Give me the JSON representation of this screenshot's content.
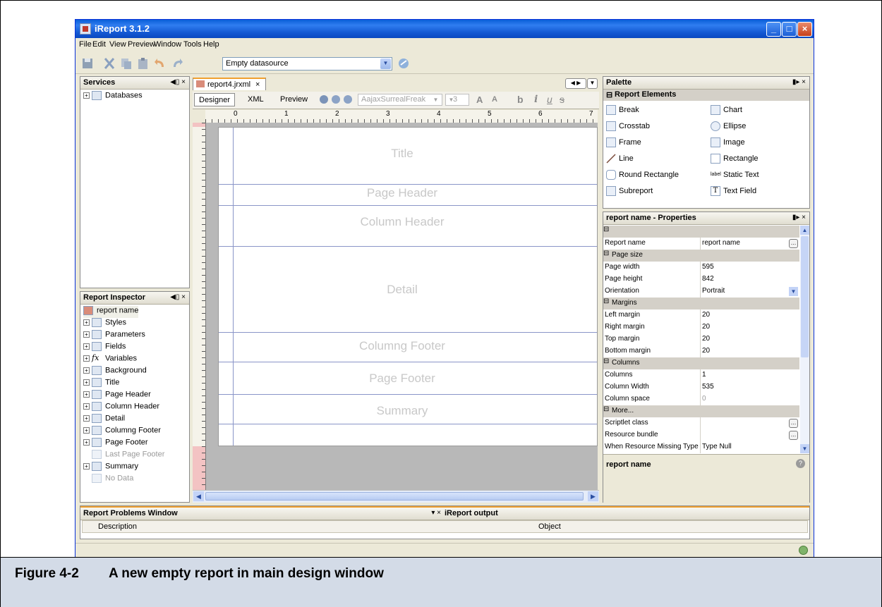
{
  "window": {
    "title": "iReport 3.1.2",
    "buttons": {
      "minimize": "_",
      "maximize": "□",
      "close": "×"
    }
  },
  "menu": [
    "File",
    "Edit",
    "View",
    "Preview",
    "Window",
    "Tools",
    "Help"
  ],
  "toolbar": {
    "datasource": "Empty datasource"
  },
  "services": {
    "title": "Services",
    "controls": "◀▯ ×",
    "items": [
      {
        "label": "Databases"
      }
    ]
  },
  "inspector": {
    "title": "Report Inspector",
    "controls": "◀▯ ×",
    "root": "report name",
    "items": [
      {
        "label": "Styles"
      },
      {
        "label": "Parameters"
      },
      {
        "label": "Fields"
      },
      {
        "label": "Variables"
      },
      {
        "label": "Background"
      },
      {
        "label": "Title"
      },
      {
        "label": "Page Header"
      },
      {
        "label": "Column Header"
      },
      {
        "label": "Detail"
      },
      {
        "label": "Columng Footer"
      },
      {
        "label": "Page Footer"
      },
      {
        "label": "Last Page Footer"
      },
      {
        "label": "Summary"
      },
      {
        "label": "No Data"
      }
    ]
  },
  "editor": {
    "tab": "report4.jrxml",
    "tab_close": "×",
    "modes": [
      "Designer",
      "XML",
      "Preview"
    ],
    "font": "AajaxSurrealFreak",
    "font_size": "3",
    "ruler_marks": [
      "0",
      "1",
      "2",
      "3",
      "4",
      "5",
      "6",
      "7"
    ],
    "bands": [
      {
        "label": "Title"
      },
      {
        "label": "Page Header"
      },
      {
        "label": "Column Header"
      },
      {
        "label": "Detail"
      },
      {
        "label": "Columng Footer"
      },
      {
        "label": "Page Footer"
      },
      {
        "label": "Summary"
      }
    ]
  },
  "palette": {
    "title": "Palette",
    "controls": "▮▸ ×",
    "section": "Report Elements",
    "items": [
      {
        "label": "Break"
      },
      {
        "label": "Chart"
      },
      {
        "label": "Crosstab"
      },
      {
        "label": "Ellipse"
      },
      {
        "label": "Frame"
      },
      {
        "label": "Image"
      },
      {
        "label": "Line"
      },
      {
        "label": "Rectangle"
      },
      {
        "label": "Round Rectangle"
      },
      {
        "label": "Static Text"
      },
      {
        "label": "Subreport"
      },
      {
        "label": "Text Field"
      }
    ]
  },
  "properties": {
    "title": "report name - Properties",
    "controls": "▮▸ ×",
    "rows": [
      {
        "type": "section",
        "key": ""
      },
      {
        "type": "prop",
        "key": "Report name",
        "value": "report name"
      },
      {
        "type": "section",
        "key": "Page size"
      },
      {
        "type": "prop",
        "key": "Page width",
        "value": "595"
      },
      {
        "type": "prop",
        "key": "Page height",
        "value": "842"
      },
      {
        "type": "prop",
        "key": "Orientation",
        "value": "Portrait"
      },
      {
        "type": "section",
        "key": "Margins"
      },
      {
        "type": "prop",
        "key": "Left margin",
        "value": "20"
      },
      {
        "type": "prop",
        "key": "Right margin",
        "value": "20"
      },
      {
        "type": "prop",
        "key": "Top margin",
        "value": "20"
      },
      {
        "type": "prop",
        "key": "Bottom margin",
        "value": "20"
      },
      {
        "type": "section",
        "key": "Columns"
      },
      {
        "type": "prop",
        "key": "Columns",
        "value": "1"
      },
      {
        "type": "prop",
        "key": "Column Width",
        "value": "535"
      },
      {
        "type": "prop",
        "key": "Column space",
        "value": "0"
      },
      {
        "type": "section",
        "key": "More..."
      },
      {
        "type": "prop",
        "key": "Scriptlet class",
        "value": ""
      },
      {
        "type": "prop",
        "key": "Resource bundle",
        "value": ""
      },
      {
        "type": "prop",
        "key": "When Resource Missing Type",
        "value": "Type Null"
      }
    ],
    "footer": "report name"
  },
  "problems": {
    "title": "Report Problems Window",
    "controls": "▾ ×",
    "columns": [
      "Description",
      "Object"
    ]
  },
  "output": {
    "title": "iReport output"
  },
  "caption": {
    "number": "Figure 4-2",
    "text": "A new empty report in main design window"
  }
}
